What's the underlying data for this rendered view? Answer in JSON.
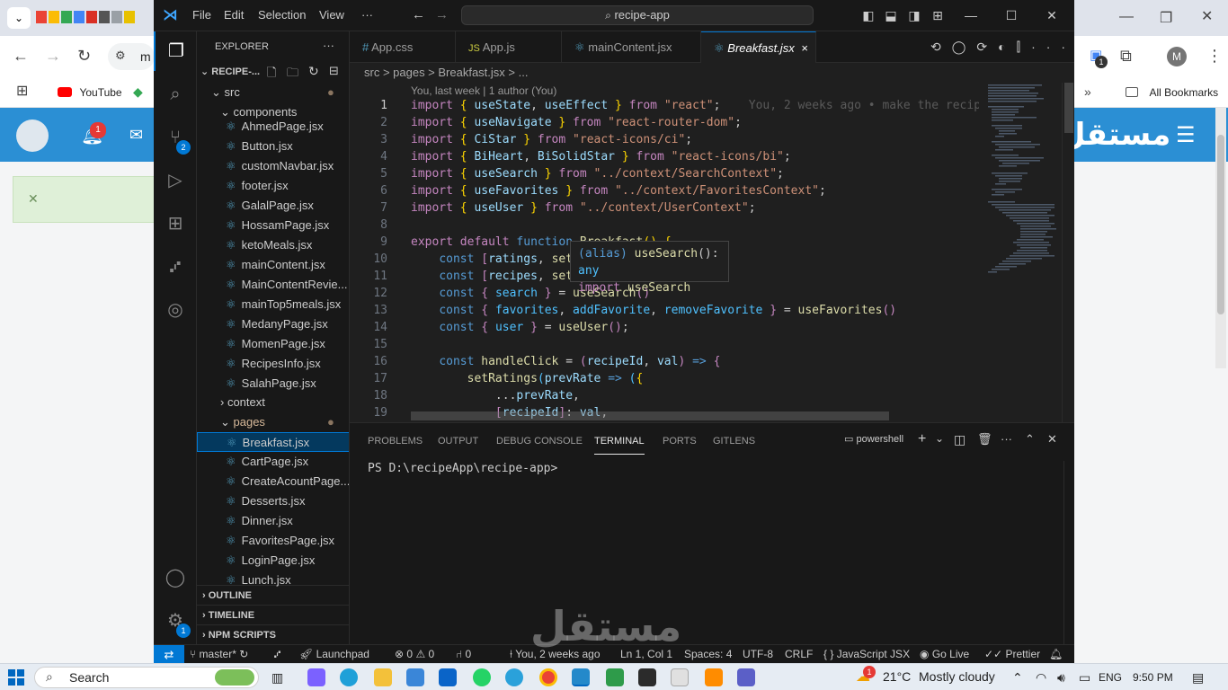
{
  "browser": {
    "bookmarks": {
      "youtube": "YouTube",
      "all": "All Bookmarks"
    },
    "address_fragment": "m",
    "notification_count": "1",
    "extension_badge": "1",
    "profile_initial": "M",
    "site_logo_text": "مستقل"
  },
  "vscode": {
    "menu": [
      "File",
      "Edit",
      "Selection",
      "View",
      "···"
    ],
    "search": "recipe-app",
    "activity_badges": {
      "scm": "2",
      "settings": "1"
    },
    "sidebar": {
      "title": "EXPLORER",
      "root": "RECIPE-...",
      "src": "src",
      "components": "components",
      "files_components": [
        "AhmedPage.jsx",
        "Button.jsx",
        "customNavbar.jsx",
        "footer.jsx",
        "GalalPage.jsx",
        "HossamPage.jsx",
        "ketoMeals.jsx",
        "mainContent.jsx",
        "MainContentRevie...",
        "mainTop5meals.jsx",
        "MedanyPage.jsx",
        "MomenPage.jsx",
        "RecipesInfo.jsx",
        "SalahPage.jsx"
      ],
      "context": "context",
      "pages": "pages",
      "files_pages": [
        "Breakfast.jsx",
        "CartPage.jsx",
        "CreateAcountPage....",
        "Desserts.jsx",
        "Dinner.jsx",
        "FavoritesPage.jsx",
        "LoginPage.jsx",
        "Lunch.jsx"
      ],
      "sections": [
        "OUTLINE",
        "TIMELINE",
        "NPM SCRIPTS"
      ]
    },
    "tabs": [
      "App.css",
      "App.js",
      "mainContent.jsx",
      "Breakfast.jsx"
    ],
    "tab_close": "×",
    "breadcrumb": "src  >  pages  >  Breakfast.jsx  >  ...",
    "blame": "You, last week | 1 author (You)",
    "ghost_text": "You, 2 weeks ago • make the recip",
    "line_numbers": [
      "1",
      "2",
      "3",
      "4",
      "5",
      "6",
      "7",
      "8",
      "9",
      "10",
      "11",
      "12",
      "13",
      "14",
      "15",
      "16",
      "17",
      "18",
      "19"
    ],
    "hover": {
      "line1": "(alias) useSearch(): any",
      "line2": "import useSearch"
    },
    "panel_tabs": [
      "PROBLEMS",
      "OUTPUT",
      "DEBUG CONSOLE",
      "TERMINAL",
      "PORTS",
      "GITLENS"
    ],
    "terminal_shell": "powershell",
    "terminal_prompt": "PS D:\\recipeApp\\recipe-app>",
    "status": {
      "branch": "master*",
      "launchpad": "Launchpad",
      "errors": "0",
      "warnings": "0",
      "ports": "0",
      "blame": "You, 2 weeks ago",
      "position": "Ln 1, Col 1",
      "spaces": "Spaces: 4",
      "encoding": "UTF-8",
      "eol": "CRLF",
      "language": "JavaScript JSX",
      "golive": "Go Live",
      "prettier": "Prettier"
    }
  },
  "taskbar": {
    "search": "Search",
    "temp": "21°C",
    "weather": "Mostly cloudy",
    "lang": "ENG",
    "time": "9:50 PM",
    "weather_badge": "1"
  },
  "watermark": "مستقل"
}
